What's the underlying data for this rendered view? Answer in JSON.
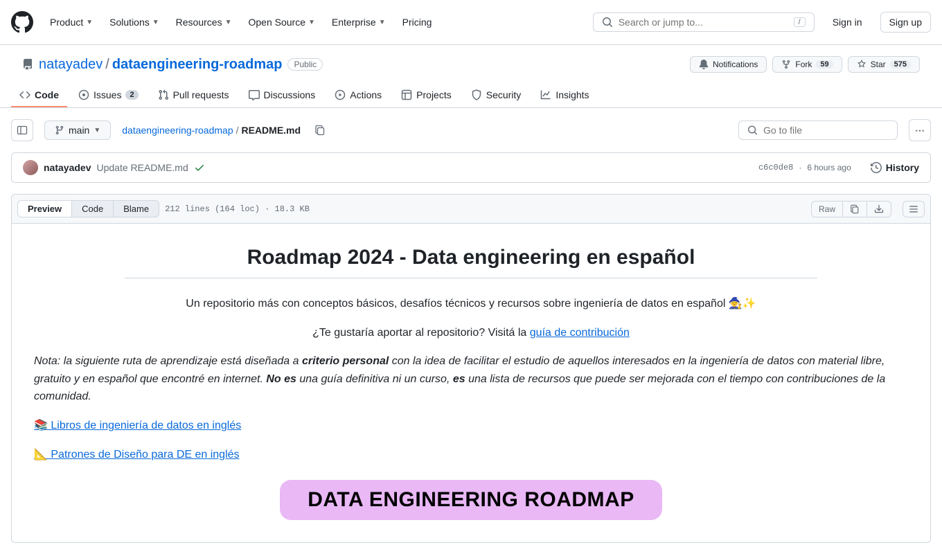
{
  "nav": {
    "items": [
      "Product",
      "Solutions",
      "Resources",
      "Open Source",
      "Enterprise"
    ],
    "pricing": "Pricing",
    "search_placeholder": "Search or jump to...",
    "slash": "/",
    "sign_in": "Sign in",
    "sign_up": "Sign up"
  },
  "repo": {
    "owner": "natayadev",
    "sep": "/",
    "name": "dataengineering-roadmap",
    "visibility": "Public",
    "actions": {
      "notifications": "Notifications",
      "fork": "Fork",
      "fork_count": "59",
      "star": "Star",
      "star_count": "575"
    }
  },
  "tabs": {
    "code": "Code",
    "issues": "Issues",
    "issues_count": "2",
    "pulls": "Pull requests",
    "discussions": "Discussions",
    "actions": "Actions",
    "projects": "Projects",
    "security": "Security",
    "insights": "Insights"
  },
  "file_nav": {
    "branch": "main",
    "crumb_root": "dataengineering-roadmap",
    "crumb_sep": "/",
    "crumb_file": "README.md",
    "goto_placeholder": "Go to file"
  },
  "commit": {
    "author": "natayadev",
    "message": "Update README.md",
    "sha": "c6c0de8",
    "dot": "·",
    "time": "6 hours ago",
    "history": "History"
  },
  "file": {
    "views": {
      "preview": "Preview",
      "code": "Code",
      "blame": "Blame"
    },
    "stats": "212 lines (164 loc) · 18.3 KB",
    "raw": "Raw"
  },
  "md": {
    "title": "Roadmap 2024 - Data engineering en español",
    "p1": "Un repositorio más con conceptos básicos, desafíos técnicos y recursos sobre ingeniería de datos en español 🧙✨",
    "p2_a": "¿Te gustaría aportar al repositorio? Visitá la ",
    "p2_link": "guía de contribución",
    "note_a": "Nota: la siguiente ruta de aprendizaje está diseñada a ",
    "note_b": "criterio personal",
    "note_c": " con la idea de facilitar el estudio de aquellos interesados en la ingeniería de datos con material libre, gratuito y en español que encontré en internet. ",
    "note_d": "No es",
    "note_e": " una guía definitiva ni un curso, ",
    "note_f": "es",
    "note_g": " una lista de recursos que puede ser mejorada con el tiempo con contribuciones de la comunidad.",
    "link1": "📚 Libros de ingeniería de datos en inglés",
    "link2": "📐 Patrones de Diseño para DE en inglés",
    "banner": "DATA ENGINEERING ROADMAP"
  }
}
